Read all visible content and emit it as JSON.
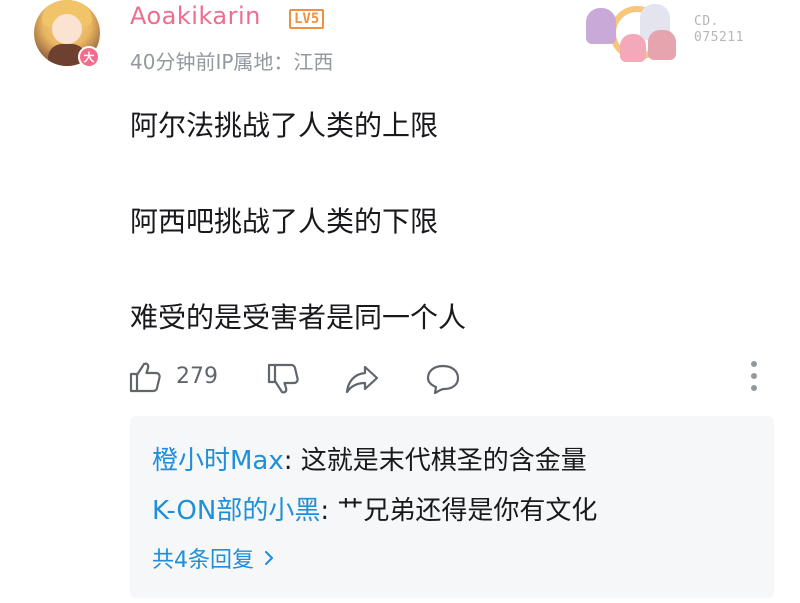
{
  "comment": {
    "author": {
      "username": "Aoakikarin",
      "level_badge": "LV5",
      "avatar_badge": "大"
    },
    "meta": "40分钟前IP属地：江西",
    "card_number_line1": "CD.",
    "card_number_line2": "075211",
    "lines": [
      "阿尔法挑战了人类的上限",
      "阿西吧挑战了人类的下限",
      "难受的是受害者是同一个人"
    ],
    "actions": {
      "like_count": "279",
      "icons": [
        "thumbs-up-icon",
        "thumbs-down-icon",
        "share-icon",
        "comment-icon",
        "more-vertical-icon"
      ]
    }
  },
  "replies": {
    "items": [
      {
        "name": "橙小时Max",
        "separator": ": ",
        "text": "这就是末代棋圣的含金量"
      },
      {
        "name": "K-ON部的小黑",
        "separator": ": ",
        "text": "艹兄弟还得是你有文化"
      }
    ],
    "more_label": "共4条回复"
  },
  "colors": {
    "username": "#ee6d8f",
    "level_badge": "#f09040",
    "meta_text": "#9499a0",
    "reply_name": "#1e8fd8",
    "reply_background": "#f6f7f8",
    "body_text": "#18191c",
    "icon": "#61666d"
  }
}
